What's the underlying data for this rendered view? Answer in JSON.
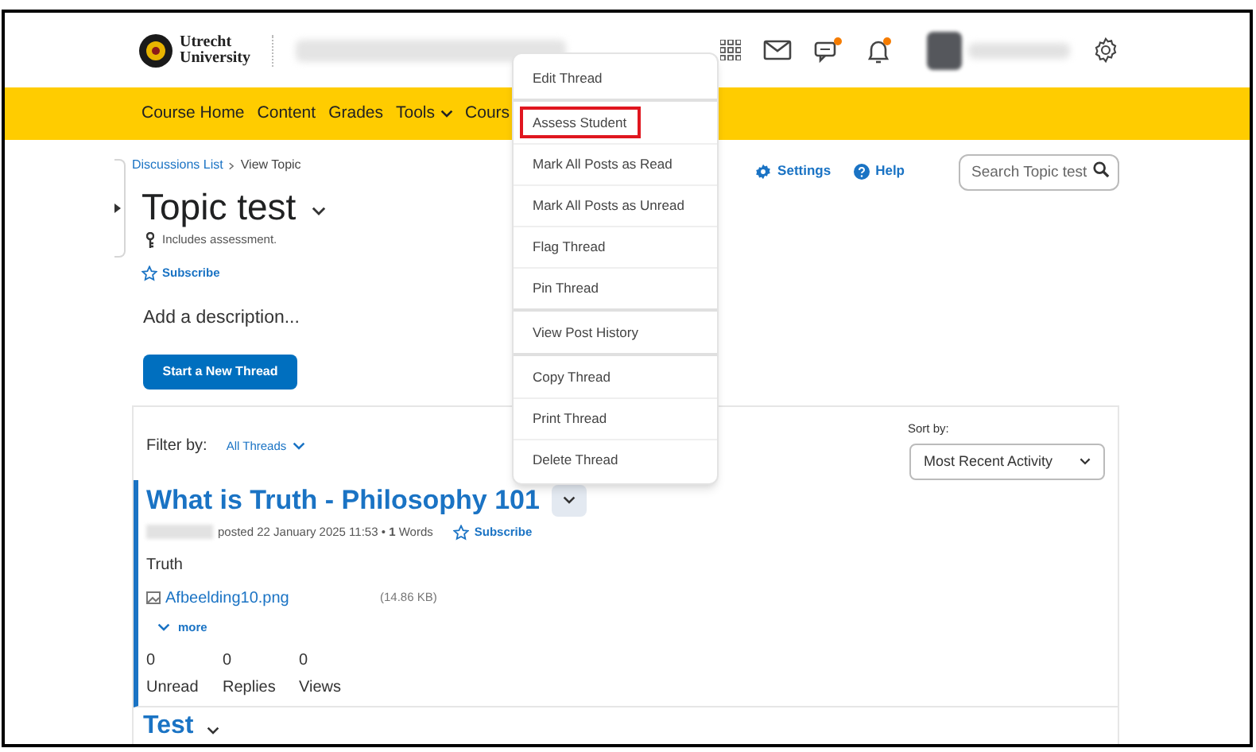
{
  "header": {
    "logo_text": "Utrecht University",
    "has_chat_alert": true,
    "has_bell_alert": true
  },
  "navbar": {
    "items": [
      {
        "label": "Course Home",
        "has_menu": false
      },
      {
        "label": "Content",
        "has_menu": false
      },
      {
        "label": "Grades",
        "has_menu": false
      },
      {
        "label": "Tools",
        "has_menu": true
      },
      {
        "label": "Cours",
        "has_menu": false
      }
    ]
  },
  "breadcrumbs": [
    {
      "label": "Discussions List",
      "link": true
    },
    {
      "label": "View Topic",
      "link": false
    }
  ],
  "toolbar": {
    "settings": "Settings",
    "help": "Help",
    "search": {
      "placeholder": "Search Topic test"
    }
  },
  "topic": {
    "title": "Topic test",
    "note": "Includes assessment.",
    "subscribe": "Subscribe",
    "description_placeholder": "Add a description...",
    "new_thread_button": "Start a New Thread"
  },
  "filter": {
    "label": "Filter by:",
    "value": "All Threads",
    "sort_label": "Sort by:",
    "sort_value": "Most Recent Activity"
  },
  "threads": [
    {
      "title": "What is Truth - Philosophy 101",
      "meta": "posted 22 January 2025 11:53 • **1** Words",
      "subscribe": "Subscribe",
      "body": "Truth",
      "attachment": {
        "name": "Afbeelding10.png",
        "size": "(14.86 KB)"
      },
      "more": "more",
      "stats": [
        {
          "value": "0",
          "label": "Unread"
        },
        {
          "value": "0",
          "label": "Replies"
        },
        {
          "value": "0",
          "label": "Views"
        }
      ]
    },
    {
      "title": "Test"
    }
  ],
  "context_menu": {
    "groups": [
      [
        {
          "label": "Edit Thread",
          "selected": false
        }
      ],
      [
        {
          "label": "Assess Student",
          "selected": true
        },
        {
          "label": "Mark All Posts as Read",
          "selected": false
        },
        {
          "label": "Mark All Posts as Unread",
          "selected": false
        },
        {
          "label": "Flag Thread",
          "selected": false
        },
        {
          "label": "Pin Thread",
          "selected": false
        }
      ],
      [
        {
          "label": "View Post History",
          "selected": false
        }
      ],
      [
        {
          "label": "Copy Thread",
          "selected": false
        },
        {
          "label": "Print Thread",
          "selected": false
        },
        {
          "label": "Delete Thread",
          "selected": false
        }
      ]
    ]
  }
}
